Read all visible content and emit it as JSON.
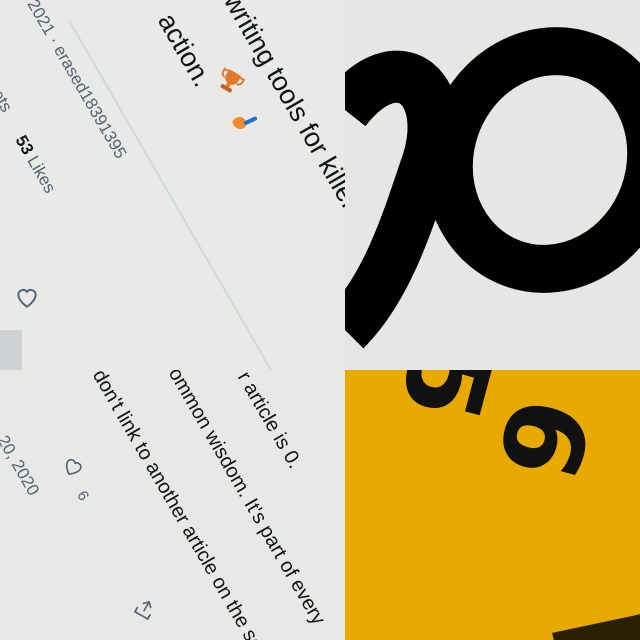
{
  "tweet_top": {
    "bio_line1": "writing tools for killer",
    "bio_line2": "action.",
    "joined_line": "2021 · erased18391395",
    "tweets_label": "eets",
    "likes_count": "53",
    "likes_label": "Likes"
  },
  "tweet_bottom": {
    "line1": "r article is 0.",
    "line2": "ommon wisdom. It's part of every",
    "line3": "don't link to another article on the sa",
    "date": "20, 2020",
    "like_count": "6"
  },
  "sign": {
    "digit_top": "5",
    "digit_bottom": "6",
    "accent_color": "#e8a900"
  },
  "icons": [
    "heart-icon",
    "share-icon",
    "trophy-emoji",
    "paintbrush-emoji",
    "curved-arrow-glyph"
  ]
}
